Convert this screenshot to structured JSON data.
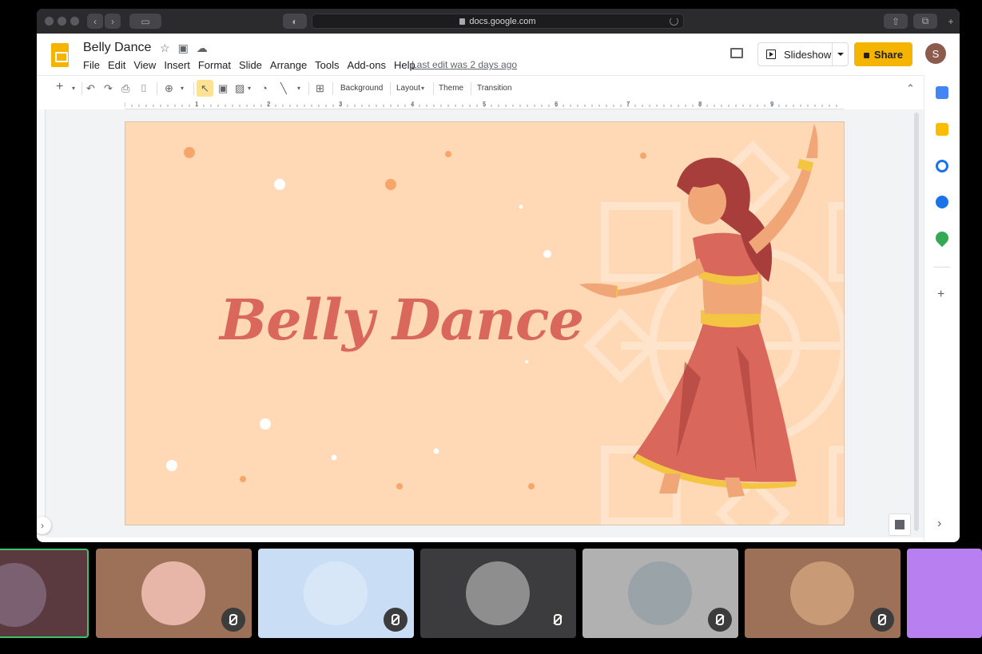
{
  "browser": {
    "url": "docs.google.com"
  },
  "doc": {
    "title": "Belly Dance",
    "menu": [
      "File",
      "Edit",
      "View",
      "Insert",
      "Format",
      "Slide",
      "Arrange",
      "Tools",
      "Add-ons",
      "Help"
    ],
    "last_edit": "Last edit was 2 days ago"
  },
  "actions": {
    "slideshow_label": "Slideshow",
    "share_label": "Share",
    "avatar_letter": "S"
  },
  "toolbar": {
    "background_label": "Background",
    "layout_label": "Layout",
    "theme_label": "Theme",
    "transition_label": "Transition"
  },
  "ruler": {
    "ticks": [
      "1",
      "2",
      "3",
      "4",
      "5",
      "6",
      "7",
      "8",
      "9"
    ]
  },
  "slide": {
    "title": "Belly Dance",
    "bg_color": "#ffd8b5",
    "title_color": "#d9675b"
  },
  "gallery": {
    "tiles": [
      {
        "bg": "#5a3a3e",
        "muted": false,
        "active": true
      },
      {
        "bg": "#9c7157",
        "muted": true
      },
      {
        "bg": "#c9def5",
        "muted": true
      },
      {
        "bg": "#3c3c3e",
        "muted": true
      },
      {
        "bg": "#b1b1b1",
        "muted": true
      },
      {
        "bg": "#9c7157",
        "muted": true
      },
      {
        "bg": "#b87ff0",
        "muted": false
      }
    ]
  }
}
